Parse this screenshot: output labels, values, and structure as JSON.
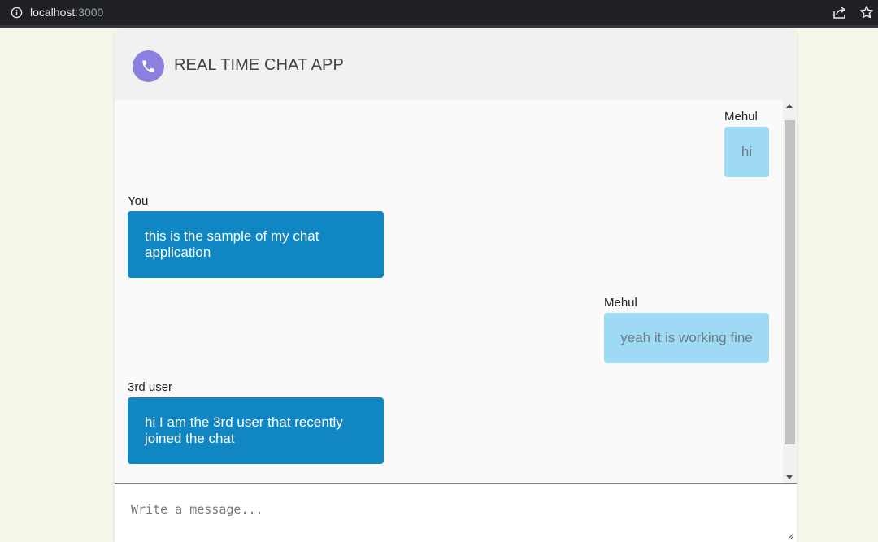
{
  "browser": {
    "host": "localhost",
    "port": ":3000"
  },
  "app": {
    "title": "REAL TIME CHAT APP",
    "icon": "phone-icon"
  },
  "messages": [
    {
      "sender": "Mehul",
      "text": "hi",
      "own": true
    },
    {
      "sender": "You",
      "text": "this is the sample of my chat application",
      "own": false
    },
    {
      "sender": "Mehul",
      "text": "yeah it is working fine",
      "own": true
    },
    {
      "sender": "3rd user",
      "text": "hi I am the 3rd user that recently joined the chat",
      "own": false
    }
  ],
  "composer": {
    "placeholder": "Write a message...",
    "value": ""
  },
  "colors": {
    "own_bubble": "#9fdaf5",
    "other_bubble": "#1086c3",
    "avatar": "#8b80e0"
  }
}
